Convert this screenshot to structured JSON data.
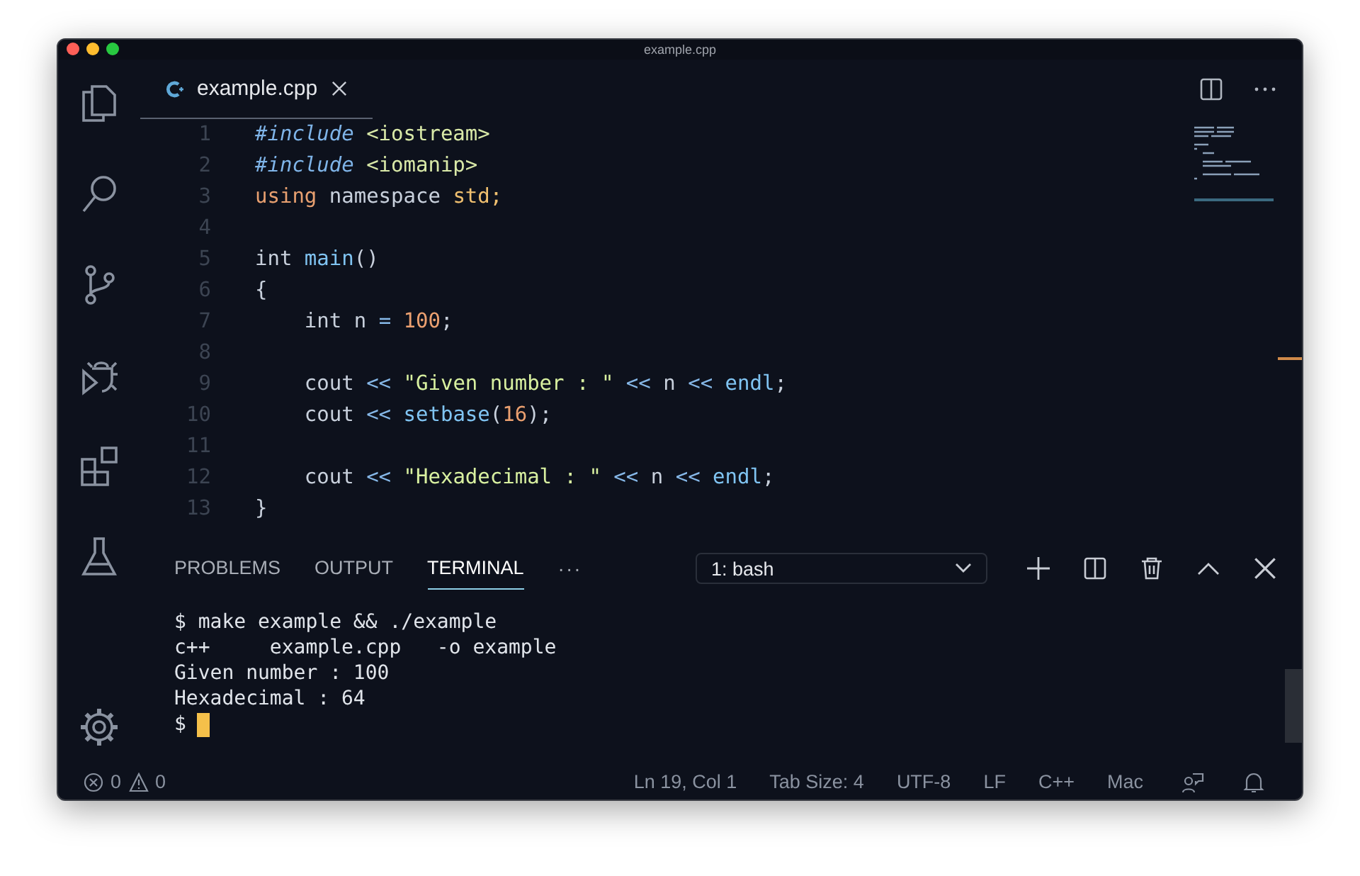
{
  "window": {
    "title": "example.cpp"
  },
  "editor_tabs": [
    {
      "label": "example.cpp",
      "selected": true
    }
  ],
  "code_lines": [
    {
      "number": "1",
      "tokens": [
        {
          "text": "#include",
          "kind": "directive"
        },
        {
          "text": " <iostream>",
          "kind": "header"
        }
      ]
    },
    {
      "number": "2",
      "tokens": [
        {
          "text": "#include",
          "kind": "directive"
        },
        {
          "text": " <iomanip>",
          "kind": "header"
        }
      ]
    },
    {
      "number": "3",
      "tokens": [
        {
          "text": "using",
          "kind": "keyword"
        },
        {
          "text": " namespace ",
          "kind": "plain"
        },
        {
          "text": "std;",
          "kind": "namespace"
        }
      ]
    },
    {
      "number": "4"
    },
    {
      "number": "5",
      "tokens": [
        {
          "text": "int ",
          "kind": "plain"
        },
        {
          "text": "main",
          "kind": "func"
        },
        {
          "text": "()",
          "kind": "plain"
        }
      ]
    },
    {
      "number": "6",
      "tokens": [
        {
          "text": "{",
          "kind": "plain"
        }
      ]
    },
    {
      "number": "7",
      "tokens": [
        {
          "text": "    int n ",
          "kind": "plain"
        },
        {
          "text": "=",
          "kind": "op"
        },
        {
          "text": " 100",
          "kind": "number"
        },
        {
          "text": ";",
          "kind": "plain"
        }
      ]
    },
    {
      "number": "8"
    },
    {
      "number": "9",
      "tokens": [
        {
          "text": "    cout ",
          "kind": "plain"
        },
        {
          "text": "<<",
          "kind": "op"
        },
        {
          "text": " \"Given number : \"",
          "kind": "string"
        },
        {
          "text": " <<",
          "kind": "op"
        },
        {
          "text": " n ",
          "kind": "plain"
        },
        {
          "text": "<<",
          "kind": "op"
        },
        {
          "text": " endl",
          "kind": "func"
        },
        {
          "text": ";",
          "kind": "plain"
        }
      ]
    },
    {
      "number": "10",
      "tokens": [
        {
          "text": "    cout ",
          "kind": "plain"
        },
        {
          "text": "<<",
          "kind": "op"
        },
        {
          "text": " setbase",
          "kind": "func"
        },
        {
          "text": "(",
          "kind": "plain"
        },
        {
          "text": "16",
          "kind": "number"
        },
        {
          "text": ");",
          "kind": "plain"
        }
      ]
    },
    {
      "number": "11"
    },
    {
      "number": "12",
      "tokens": [
        {
          "text": "    cout ",
          "kind": "plain"
        },
        {
          "text": "<<",
          "kind": "op"
        },
        {
          "text": " \"Hexadecimal : \"",
          "kind": "string"
        },
        {
          "text": " <<",
          "kind": "op"
        },
        {
          "text": " n ",
          "kind": "plain"
        },
        {
          "text": "<<",
          "kind": "op"
        },
        {
          "text": " endl",
          "kind": "func"
        },
        {
          "text": ";",
          "kind": "plain"
        }
      ]
    },
    {
      "number": "13",
      "tokens": [
        {
          "text": "}",
          "kind": "plain"
        }
      ]
    }
  ],
  "panel": {
    "tabs": [
      {
        "label": "PROBLEMS",
        "selected": false
      },
      {
        "label": "OUTPUT",
        "selected": false
      },
      {
        "label": "TERMINAL",
        "selected": true
      }
    ],
    "more": "···",
    "terminal_select": "1: bash",
    "terminal_lines": [
      "$ make example && ./example",
      "c++     example.cpp   -o example",
      "Given number : 100",
      "Hexadecimal : 64"
    ],
    "prompt": "$"
  },
  "status_bar": {
    "errors": "0",
    "warnings": "0",
    "items": [
      "Ln 19, Col 1",
      "Tab Size: 4",
      "UTF-8",
      "LF",
      "C++",
      "Mac"
    ]
  }
}
